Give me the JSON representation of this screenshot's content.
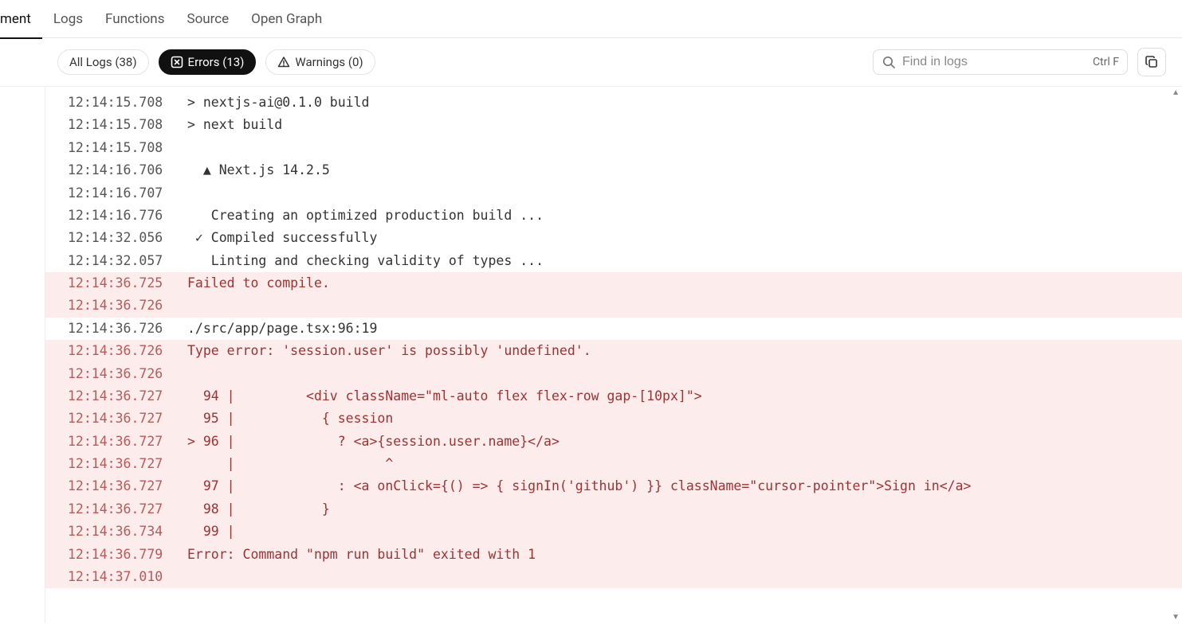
{
  "tabs": {
    "partial_first": "ment",
    "logs": "Logs",
    "functions": "Functions",
    "source": "Source",
    "open_graph": "Open Graph"
  },
  "filters": {
    "all_logs": "All Logs (38)",
    "errors": "Errors (13)",
    "warnings": "Warnings (0)"
  },
  "search": {
    "placeholder": "Find in logs",
    "shortcut": "Ctrl F"
  },
  "logs": [
    {
      "ts": "12:14:15.708",
      "msg": "> nextjs-ai@0.1.0 build",
      "type": "neutral"
    },
    {
      "ts": "12:14:15.708",
      "msg": "> next build",
      "type": "neutral"
    },
    {
      "ts": "12:14:15.708",
      "msg": "",
      "type": "neutral"
    },
    {
      "ts": "12:14:16.706",
      "msg": "  ▲ Next.js 14.2.5",
      "type": "neutral"
    },
    {
      "ts": "12:14:16.707",
      "msg": "",
      "type": "neutral"
    },
    {
      "ts": "12:14:16.776",
      "msg": "   Creating an optimized production build ...",
      "type": "neutral"
    },
    {
      "ts": "12:14:32.056",
      "msg": " ✓ Compiled successfully",
      "type": "neutral"
    },
    {
      "ts": "12:14:32.057",
      "msg": "   Linting and checking validity of types ...",
      "type": "neutral"
    },
    {
      "ts": "12:14:36.725",
      "msg": "Failed to compile.",
      "type": "error"
    },
    {
      "ts": "12:14:36.726",
      "msg": "",
      "type": "error"
    },
    {
      "ts": "12:14:36.726",
      "msg": "./src/app/page.tsx:96:19",
      "type": "neutral"
    },
    {
      "ts": "12:14:36.726",
      "msg": "Type error: 'session.user' is possibly 'undefined'.",
      "type": "error"
    },
    {
      "ts": "12:14:36.726",
      "msg": "",
      "type": "error"
    },
    {
      "ts": "12:14:36.727",
      "msg": "  94 |         <div className=\"ml-auto flex flex-row gap-[10px]\">",
      "type": "error"
    },
    {
      "ts": "12:14:36.727",
      "msg": "  95 |           { session",
      "type": "error"
    },
    {
      "ts": "12:14:36.727",
      "msg": "> 96 |             ? <a>{session.user.name}</a>",
      "type": "error"
    },
    {
      "ts": "12:14:36.727",
      "msg": "     |                   ^",
      "type": "error"
    },
    {
      "ts": "12:14:36.727",
      "msg": "  97 |             : <a onClick={() => { signIn('github') }} className=\"cursor-pointer\">Sign in</a>",
      "type": "error"
    },
    {
      "ts": "12:14:36.727",
      "msg": "  98 |           }",
      "type": "error"
    },
    {
      "ts": "12:14:36.734",
      "msg": "  99 | ",
      "type": "error"
    },
    {
      "ts": "12:14:36.779",
      "msg": "Error: Command \"npm run build\" exited with 1",
      "type": "error"
    },
    {
      "ts": "12:14:37.010",
      "msg": "",
      "type": "error"
    }
  ]
}
